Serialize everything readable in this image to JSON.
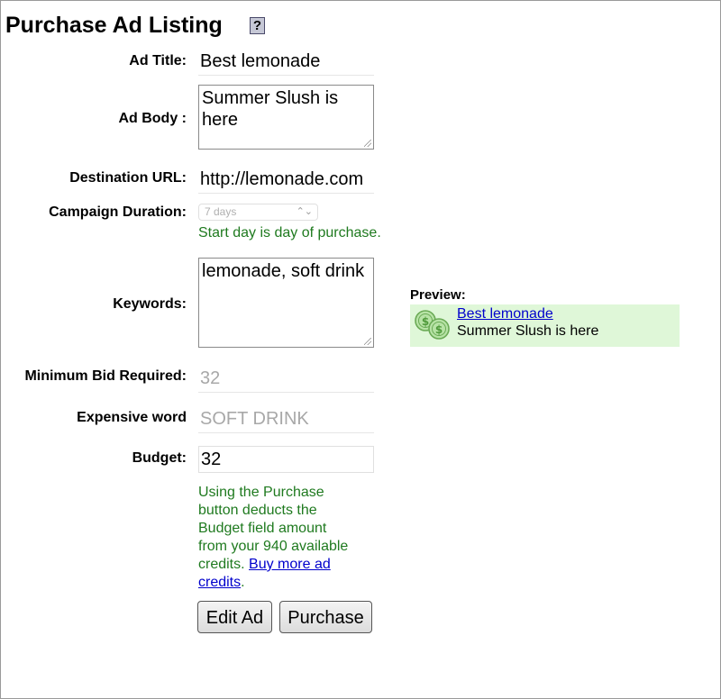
{
  "page": {
    "title": "Purchase Ad Listing",
    "help_label": "?"
  },
  "form": {
    "ad_title": {
      "label": "Ad Title:",
      "value": "Best lemonade"
    },
    "ad_body": {
      "label": "Ad Body :",
      "value": "Summer Slush is here"
    },
    "destination_url": {
      "label": "Destination URL:",
      "value": "http://lemonade.com"
    },
    "campaign_duration": {
      "label": "Campaign Duration:",
      "selected": "7 days",
      "note": "Start day is day of purchase."
    },
    "keywords": {
      "label": "Keywords:",
      "value": "lemonade, soft drink"
    },
    "minimum_bid": {
      "label": "Minimum Bid Required:",
      "value": "32"
    },
    "expensive_word": {
      "label": "Expensive word",
      "value": "SOFT DRINK"
    },
    "budget": {
      "label": "Budget:",
      "value": "32",
      "note_text": "Using the Purchase button deducts the Budget field amount from your 940 available credits.",
      "note_link": "Buy more ad credits",
      "note_end": "."
    }
  },
  "buttons": {
    "edit_label": "Edit Ad",
    "purchase_label": "Purchase"
  },
  "preview": {
    "label": "Preview:",
    "title": "Best lemonade",
    "body": "Summer Slush is here",
    "icon": "coins-icon",
    "background": "#dff7d8"
  },
  "colors": {
    "note_green": "#1f7a1f",
    "link_blue": "#0000cc"
  }
}
